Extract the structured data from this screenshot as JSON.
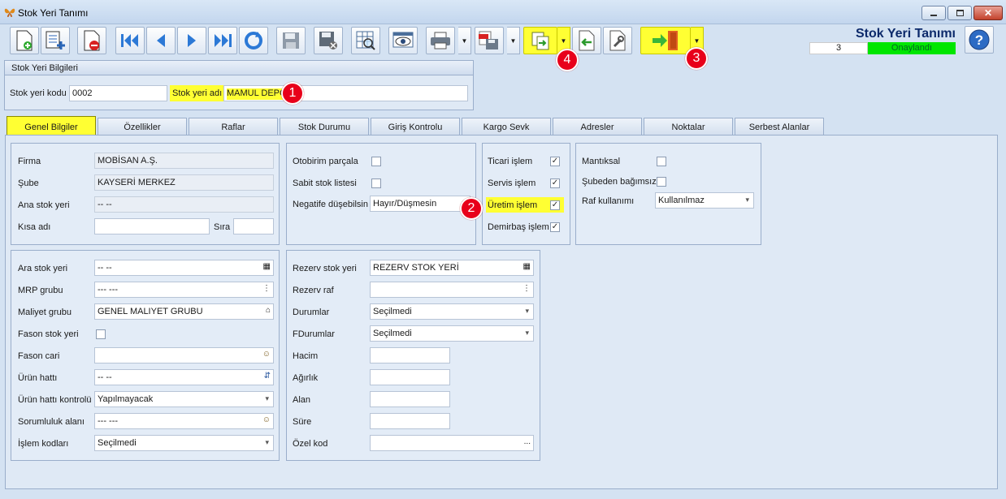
{
  "window": {
    "title": "Stok Yeri Tanımı"
  },
  "header": {
    "form_title": "Stok Yeri Tanımı",
    "record_no": "3",
    "status": "Onaylandı",
    "status_color": "#00e600"
  },
  "markers": [
    "1",
    "2",
    "3",
    "4"
  ],
  "toolbar": {
    "buttons": [
      "new-document-icon",
      "add-item-icon",
      "delete-icon",
      "first-record-icon",
      "previous-record-icon",
      "next-record-icon",
      "last-record-icon",
      "refresh-icon",
      "save-icon",
      "save-cancel-icon",
      "grid-search-icon",
      "preview-icon",
      "print-icon",
      "pdf-save-icon",
      "transfer-icon",
      "import-icon",
      "tools-icon",
      "exit-icon",
      "help-icon"
    ]
  },
  "stock_info": {
    "group_title": "Stok Yeri Bilgileri",
    "code_label": "Stok yeri kodu",
    "code_value": "0002",
    "name_label": "Stok yeri adı",
    "name_value": "MAMUL DEPO"
  },
  "tabs": [
    "Genel Bilgiler",
    "Özellikler",
    "Raflar",
    "Stok Durumu",
    "Giriş Kontrolu",
    "Kargo Sevk",
    "Adresler",
    "Noktalar",
    "Serbest Alanlar"
  ],
  "general": {
    "firma_label": "Firma",
    "firma_value": "MOBİSAN A.Ş.",
    "sube_label": "Şube",
    "sube_value": "KAYSERİ MERKEZ",
    "ana_label": "Ana stok yeri",
    "ana_value": "-- --",
    "kisa_label": "Kısa adı",
    "kisa_value": "",
    "sira_label": "Sıra",
    "sira_value": ""
  },
  "options1": {
    "otobirim_label": "Otobirim parçala",
    "sabit_label": "Sabit stok listesi",
    "negatif_label": "Negatife düşebilsin",
    "negatif_value": "Hayır/Düşmesin"
  },
  "options2": {
    "ticari_label": "Ticari işlem",
    "servis_label": "Servis işlem",
    "uretim_label": "Üretim işlem",
    "demirbas_label": "Demirbaş işlem",
    "checked_mark": "✓"
  },
  "options3": {
    "mantiksal_label": "Mantıksal",
    "subeden_label": "Şubeden bağımsız",
    "raf_label": "Raf kullanımı",
    "raf_value": "Kullanılmaz"
  },
  "left_fields": [
    {
      "label": "Ara stok yeri",
      "value": "-- --"
    },
    {
      "label": "MRP grubu",
      "value": "--- ---"
    },
    {
      "label": "Maliyet grubu",
      "value": "GENEL MALIYET GRUBU"
    },
    {
      "label": "Fason stok yeri",
      "value": ""
    },
    {
      "label": "Fason cari",
      "value": ""
    },
    {
      "label": "Ürün hattı",
      "value": "-- --"
    },
    {
      "label": "Ürün hattı kontrolü",
      "value": "Yapılmayacak"
    },
    {
      "label": "Sorumluluk alanı",
      "value": "--- ---"
    },
    {
      "label": "İşlem kodları",
      "value": "Seçilmedi"
    }
  ],
  "right_fields": [
    {
      "label": "Rezerv stok yeri",
      "value": "REZERV STOK YERİ"
    },
    {
      "label": "Rezerv raf",
      "value": ""
    },
    {
      "label": "Durumlar",
      "value": "Seçilmedi"
    },
    {
      "label": "FDurumlar",
      "value": "Seçilmedi"
    },
    {
      "label": "Hacim",
      "value": ""
    },
    {
      "label": "Ağırlık",
      "value": ""
    },
    {
      "label": "Alan",
      "value": ""
    },
    {
      "label": "Süre",
      "value": ""
    },
    {
      "label": "Özel kod",
      "value": ""
    }
  ],
  "icons": {
    "ellipsis": "...",
    "lookup": "▦",
    "tree": "⋮",
    "bank": "⌂",
    "people": "☺",
    "line": "⇵"
  },
  "colors": {
    "highlight": "#ffff33",
    "marker": "#e8001a"
  }
}
